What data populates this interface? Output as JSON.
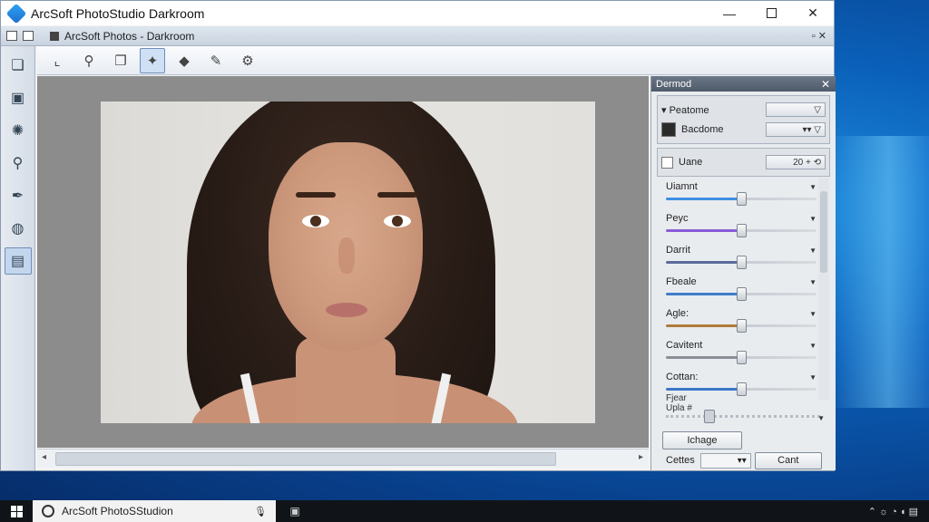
{
  "window": {
    "title": "ArcSoft PhotoStudio Darkroom",
    "minimize": "—",
    "maximize": "",
    "close": "✕"
  },
  "mdi": {
    "title": "ArcSoft Photos - Darkroom",
    "controls": "▫ ✕"
  },
  "panel": {
    "title": "Dermod",
    "close": "✕",
    "rows": [
      {
        "label": "▾ Peatome",
        "value": "▽"
      },
      {
        "label": "Bacdome",
        "value": "▾▾ ▽"
      },
      {
        "label": "Uane",
        "value": "20 +   ⟲"
      }
    ],
    "sliders": [
      {
        "name": "Uiamnt",
        "level": 0.5,
        "color": "#3e8fe0"
      },
      {
        "name": "Peyc",
        "level": 0.5,
        "color": "#8a5bd8"
      },
      {
        "name": "Darrit",
        "level": 0.5,
        "color": "#5a6b9a"
      },
      {
        "name": "Fbeale",
        "level": 0.5,
        "color": "#3f7fc8"
      },
      {
        "name": "Agle:",
        "level": 0.5,
        "color": "#b07a3a"
      },
      {
        "name": "Cavitent",
        "level": 0.5,
        "color": "#8a8f96"
      },
      {
        "name": "Cottan:",
        "level": 0.5,
        "color": "#3a78c8"
      }
    ],
    "extra_label_1": "Fjear",
    "extra_label_2": "Upla #",
    "change_button": "Ichage",
    "bottom_label": "Cettes",
    "bottom_combo": "▾▾",
    "cancel_button": "Cant"
  },
  "taskbar": {
    "search_text": "ArcSoft PhotoSStudion",
    "tray": "⌃  ☼  ◔  ◖  ▤"
  },
  "icons": {
    "toolbar": [
      "crop-icon",
      "zoom-icon",
      "layers-icon",
      "enhance-icon",
      "shield-icon",
      "brush-icon",
      "gear-icon"
    ],
    "left": [
      "copy-icon",
      "edit-icon",
      "effects-icon",
      "search-icon",
      "pen-icon",
      "globe-icon",
      "frame-icon"
    ]
  }
}
